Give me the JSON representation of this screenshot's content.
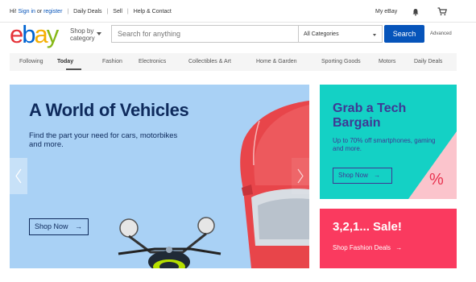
{
  "topbar": {
    "greeting": "Hi!",
    "sign_in": "Sign in",
    "or": "or",
    "register": "register",
    "daily_deals": "Daily Deals",
    "sell": "Sell",
    "help": "Help & Contact",
    "my_ebay": "My eBay",
    "bell_icon": "bell-icon",
    "cart_icon": "cart-icon"
  },
  "header": {
    "logo_letters": [
      "e",
      "b",
      "a",
      "y"
    ],
    "logo_colors": [
      "#e53238",
      "#0064d2",
      "#f5af02",
      "#86b817"
    ],
    "shop_by_line1": "Shop by",
    "shop_by_line2": "category",
    "search_placeholder": "Search for anything",
    "category_selected": "All Categories",
    "search_button": "Search",
    "advanced": "Advanced"
  },
  "nav": {
    "items": [
      "Following",
      "Today",
      "Fashion",
      "Electronics",
      "Collectibles & Art",
      "Home & Garden",
      "Sporting Goods",
      "Motors",
      "Daily Deals"
    ],
    "active": "Today"
  },
  "hero": {
    "title": "A World of Vehicles",
    "subtitle": "Find the part your need for cars, motorbikes and more.",
    "cta": "Shop Now",
    "cta_arrow": "→",
    "colors": {
      "background": "#a9d1f5",
      "car": "#e8454a",
      "text": "#0e2a5c"
    }
  },
  "promo_tech": {
    "title_line1": "Grab a Tech",
    "title_line2": "Bargain",
    "subtitle": "Up to 70% off smartphones, gaming and more.",
    "cta": "Shop Now",
    "cta_arrow": "→",
    "badge": "%",
    "colors": {
      "background": "#14d1c5",
      "accent": "#fbc4cc",
      "text": "#3f3894"
    }
  },
  "promo_sale": {
    "title": "3,2,1... Sale!",
    "link": "Shop Fashion Deals",
    "link_arrow": "→",
    "colors": {
      "background": "#fa3a5f"
    }
  }
}
